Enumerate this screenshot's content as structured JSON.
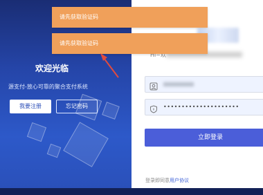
{
  "left": {
    "welcome": "欢迎光临",
    "tagline": "源支付-放心可靠的聚合支付系统",
    "register_label": "我要注册",
    "forgot_label": "忘记密码"
  },
  "right": {
    "subtitle": "Hi~欢",
    "username_placeholder": "",
    "password_value": "•••••••••••••••••••••",
    "login_label": "立即登录",
    "agree_prefix": "登录即同意",
    "agree_link": "用户协议"
  },
  "toasts": [
    {
      "text": "请先获取验证码"
    },
    {
      "text": "请先获取验证码"
    }
  ],
  "colors": {
    "toast": "#f0a05a",
    "primary": "#4b5ed9",
    "annotation_arrow": "#e04b3f"
  }
}
